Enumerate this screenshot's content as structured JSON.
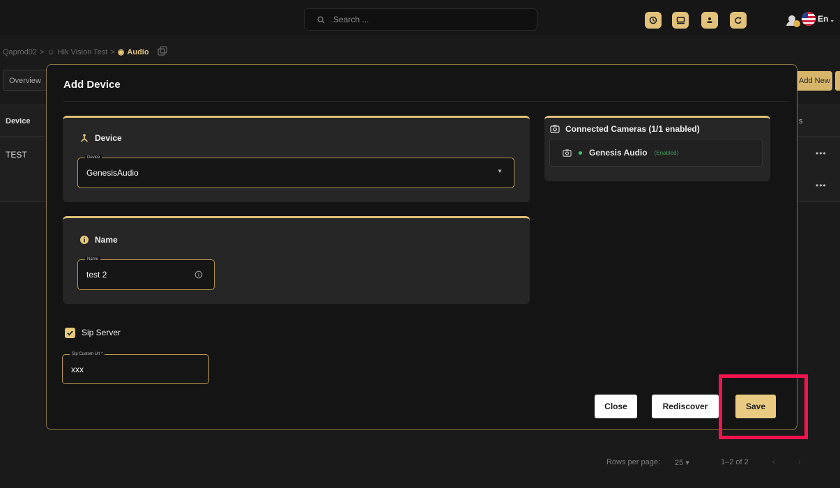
{
  "topbar": {
    "search_placeholder": "Search ...",
    "icons": [
      "clock-icon",
      "monitor-icon",
      "user-icon",
      "refresh-icon"
    ],
    "language": "En"
  },
  "breadcrumb": {
    "items": [
      "Qaprod02",
      "Hik Vision Test",
      "Audio"
    ],
    "separator": ">"
  },
  "background": {
    "tab_label": "Overview",
    "add_new_label": "Add New",
    "table": {
      "columns": [
        "Device",
        "Actions"
      ],
      "rows": [
        {
          "device": "TEST"
        }
      ],
      "row_menu": "•••"
    },
    "pagination": {
      "rows_per_page_label": "Rows per page:",
      "rows_per_page_value": "25",
      "range": "1–2 of 2"
    }
  },
  "modal": {
    "title": "Add Device",
    "device_section": {
      "title": "Device",
      "field_label": "Device",
      "field_value": "GenesisAudio"
    },
    "name_section": {
      "title": "Name",
      "field_label": "Name",
      "field_value": "test 2"
    },
    "cameras": {
      "title": "Connected Cameras (1/1 enabled)",
      "items": [
        {
          "name": "Genesis Audio",
          "status": "(Enabled)"
        }
      ]
    },
    "sip": {
      "checkbox_label": "Sip Server",
      "checked": true,
      "field_label": "Sip Custom Url *",
      "field_value": "xxx"
    },
    "buttons": {
      "close": "Close",
      "rediscover": "Rediscover",
      "save": "Save"
    }
  },
  "colors": {
    "accent": "#e0c178",
    "highlight": "#f2134f",
    "status_enabled": "#3ec26a"
  }
}
